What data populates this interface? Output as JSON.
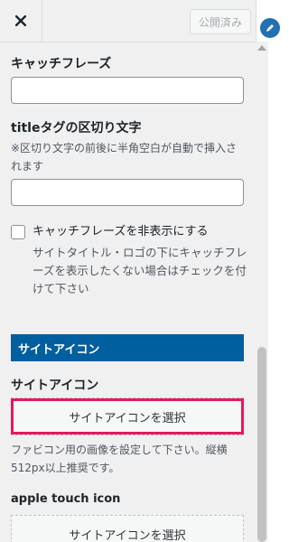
{
  "header": {
    "close_icon": "close-icon",
    "publish_label": "公開済み"
  },
  "catchphrase": {
    "label": "キャッチフレーズ",
    "value": ""
  },
  "title_separator": {
    "label": "titleタグの区切り文字",
    "description": "※区切り文字の前後に半角空白が自動で挿入されます",
    "value": ""
  },
  "hide_catchphrase": {
    "label": "キャッチフレーズを非表示にする",
    "checked": false,
    "description": "サイトタイトル・ロゴの下にキャッチフレーズを表示したくない場合はチェックを付けて下さい"
  },
  "site_icon_section": {
    "bar_title": "サイトアイコン",
    "label": "サイトアイコン",
    "button_label": "サイトアイコンを選択",
    "description": "ファビコン用の画像を設定して下さい。縦横512px以上推奨です。"
  },
  "apple_touch_icon": {
    "label": "apple touch icon",
    "button_label": "サイトアイコンを選択"
  },
  "colors": {
    "section_bar": "#005f9e",
    "highlight": "#e8175d",
    "edit_badge": "#2271b1"
  }
}
